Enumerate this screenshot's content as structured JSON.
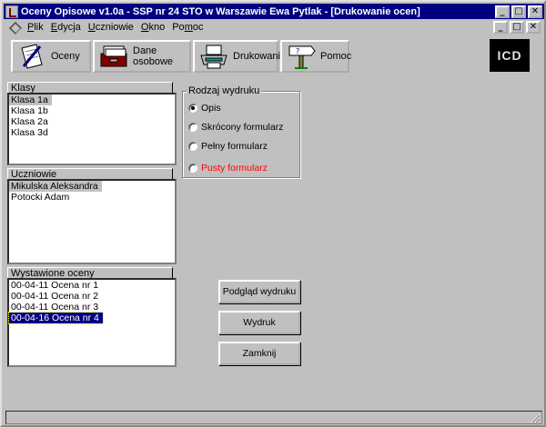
{
  "window": {
    "title": "Oceny Opisowe v1.0a - SSP nr 24 STO w Warszawie Ewa Pytlak - [Drukowanie ocen]",
    "controls": {
      "minimize": "_",
      "maximize": "□",
      "close": "✕"
    }
  },
  "menu": [
    {
      "prefix": "",
      "ul": "P",
      "rest": "lik"
    },
    {
      "prefix": "",
      "ul": "E",
      "rest": "dycja"
    },
    {
      "prefix": "",
      "ul": "U",
      "rest": "czniowie"
    },
    {
      "prefix": "",
      "ul": "O",
      "rest": "kno"
    },
    {
      "prefix": "Po",
      "ul": "m",
      "rest": "oc"
    }
  ],
  "toolbar": {
    "oceny": "Oceny",
    "dane_osobowe": "Dane osobowe",
    "drukowanie": "Drukowanie",
    "pomoc": "Pomoc",
    "logo": "ICD"
  },
  "klasy": {
    "header": "Klasy",
    "items": [
      "Klasa 1a",
      "Klasa 1b",
      "Klasa 2a",
      "Klasa 3d"
    ],
    "selected": 0
  },
  "uczniowie": {
    "header": "Uczniowie",
    "items": [
      "Mikulska Aleksandra",
      "Potocki Adam"
    ],
    "selected": 0
  },
  "oceny": {
    "header": "Wystawione oceny",
    "items": [
      "00-04-11 Ocena nr 1",
      "00-04-11 Ocena nr 2",
      "00-04-11 Ocena nr 3",
      "00-04-16 Ocena nr 4"
    ],
    "selected": 3
  },
  "rodzaj": {
    "title": "Rodzaj wydruku",
    "options": [
      {
        "label": "Opis",
        "checked": true,
        "color": "#000000"
      },
      {
        "label": "Skrócony formularz",
        "checked": false,
        "color": "#000000"
      },
      {
        "label": "Pełny formularz",
        "checked": false,
        "color": "#000000"
      },
      {
        "label": "Pusty formularz",
        "checked": false,
        "color": "#ff0000"
      }
    ]
  },
  "buttons": {
    "podglad": "Podgląd wydruku",
    "wydruk": "Wydruk",
    "zamknij": "Zamknij"
  }
}
